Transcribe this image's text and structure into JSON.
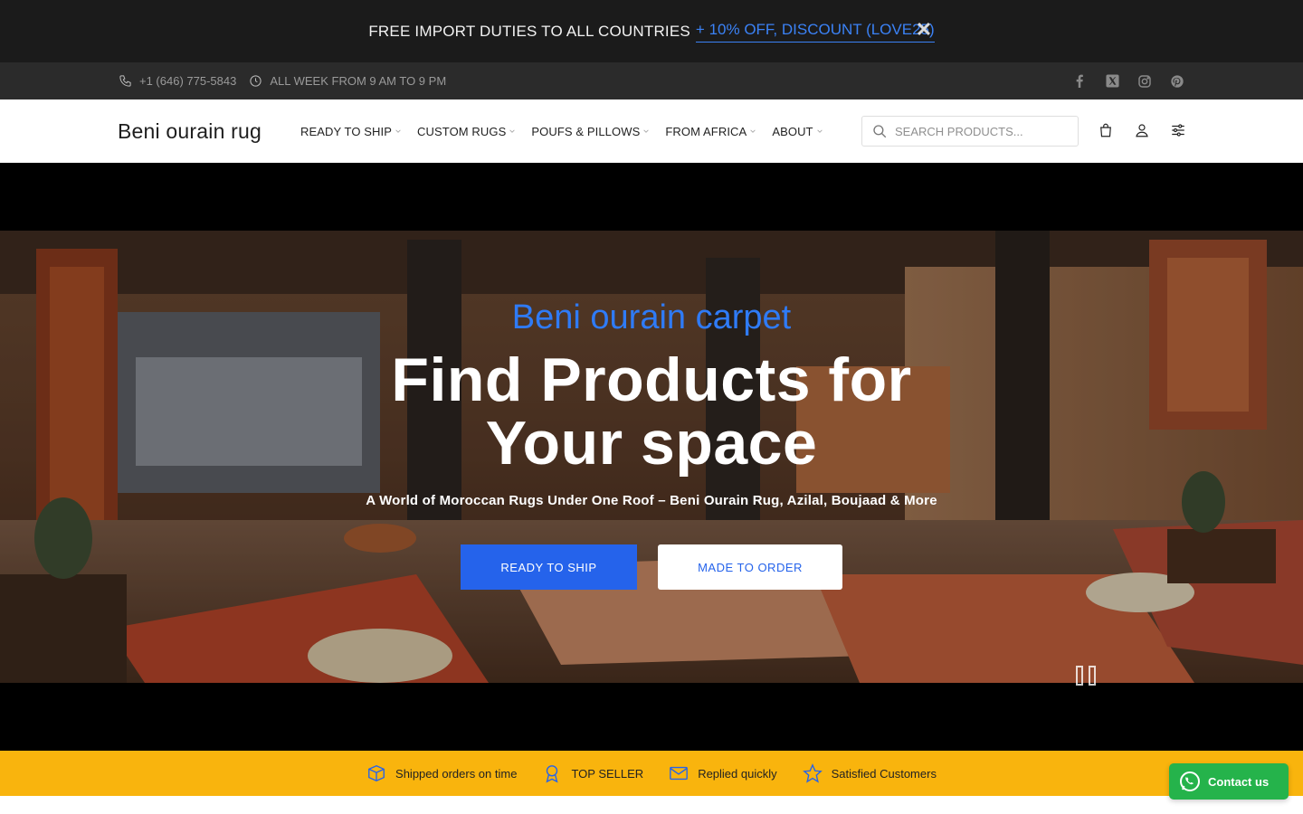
{
  "promo": {
    "text": "FREE IMPORT DUTIES TO ALL COUNTRIES",
    "link": "+ 10% OFF, DISCOUNT (LOVE25)",
    "close": "✕"
  },
  "info": {
    "phone": "+1 (646) 775-5843",
    "hours": "ALL WEEK FROM 9 AM TO 9 PM"
  },
  "header": {
    "logo": "Beni ourain rug",
    "nav": [
      "READY TO SHIP",
      "CUSTOM RUGS",
      "POUFS & PILLOWS",
      "FROM AFRICA",
      "ABOUT"
    ],
    "search_placeholder": "SEARCH PRODUCTS..."
  },
  "hero": {
    "eyebrow": "Beni ourain carpet",
    "title_line1": "Find Products for",
    "title_line2": "Your space",
    "subtitle": "A World of Moroccan Rugs Under One Roof – Beni Ourain Rug, Azilal, Boujaad & More",
    "btn_ship": "READY TO SHIP",
    "btn_order": "MADE TO ORDER"
  },
  "features": [
    "Shipped orders on time",
    "TOP SELLER",
    "Replied quickly",
    "Satisfied Customers"
  ],
  "contact": {
    "label": "Contact us"
  },
  "colors": {
    "accent": "#2563eb",
    "features_bg": "#f9b40d",
    "whatsapp": "#25b34b",
    "promo_bg": "#1b1b1b",
    "info_bg": "#2b2b2b"
  }
}
